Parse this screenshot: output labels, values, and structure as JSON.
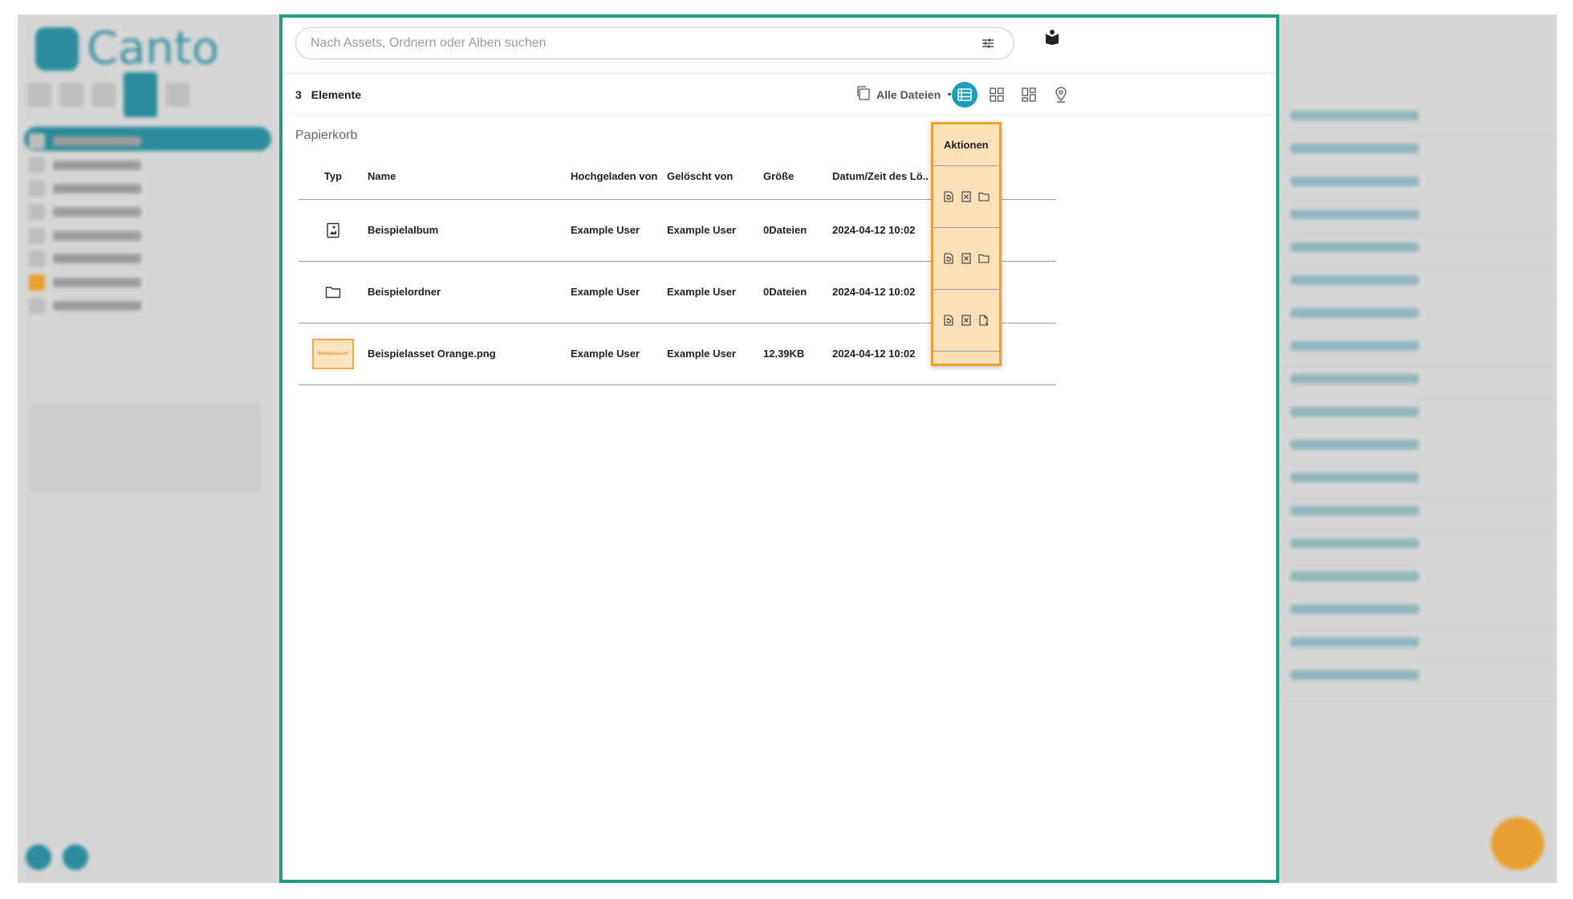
{
  "brand": {
    "name": "Canto"
  },
  "search": {
    "placeholder": "Nach Assets, Ordnern oder Alben suchen"
  },
  "toolbar": {
    "count": "3",
    "count_label": "Elemente",
    "filter_label": "Alle Dateien"
  },
  "section_title": "Papierkorb",
  "columns": [
    "Typ",
    "Name",
    "Hochgeladen von",
    "Gelöscht von",
    "Größe",
    "Datum/Zeit des Lö..",
    "Aktionen"
  ],
  "rows": [
    {
      "type": "album",
      "name": "Beispielalbum",
      "uploaded_by": "Example User",
      "deleted_by": "Example User",
      "size": "0Dateien",
      "datetime": "2024-04-12 10:02",
      "actions": [
        "restore-icon",
        "delete-permanently-icon",
        "folder-icon"
      ]
    },
    {
      "type": "folder",
      "name": "Beispielordner",
      "uploaded_by": "Example User",
      "deleted_by": "Example User",
      "size": "0Dateien",
      "datetime": "2024-04-12 10:02",
      "actions": [
        "restore-icon",
        "delete-permanently-icon",
        "folder-icon"
      ]
    },
    {
      "type": "image",
      "thumb_text": "Beispielasset",
      "name": "Beispielasset Orange.png",
      "uploaded_by": "Example User",
      "deleted_by": "Example User",
      "size": "12.39KB",
      "datetime": "2024-04-12 10:02",
      "actions": [
        "restore-icon",
        "delete-permanently-icon",
        "file-icon"
      ]
    }
  ],
  "colors": {
    "highlight_border": "#1aa184",
    "actions_highlight": "#f29d2a",
    "accent": "#1e9db8"
  }
}
